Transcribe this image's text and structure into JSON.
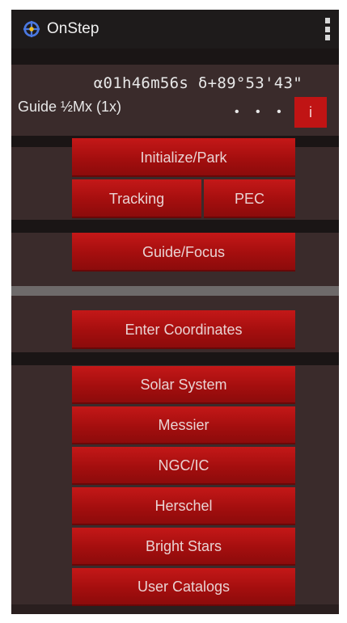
{
  "app": {
    "title": "OnStep"
  },
  "status": {
    "coordinates": "α01h46m56s δ+89°53'43\"",
    "guide_rate": "Guide ½Mx (1x)",
    "dots": "• • •",
    "info_label": "i"
  },
  "buttons": {
    "initialize_park": "Initialize/Park",
    "tracking": "Tracking",
    "pec": "PEC",
    "guide_focus": "Guide/Focus",
    "enter_coordinates": "Enter Coordinates"
  },
  "catalogs": [
    "Solar System",
    "Messier",
    "NGC/IC",
    "Herschel",
    "Bright Stars",
    "User Catalogs"
  ],
  "colors": {
    "button_red": "#b01010",
    "background": "#2a1f1f",
    "appbar": "#1e1b1b"
  }
}
